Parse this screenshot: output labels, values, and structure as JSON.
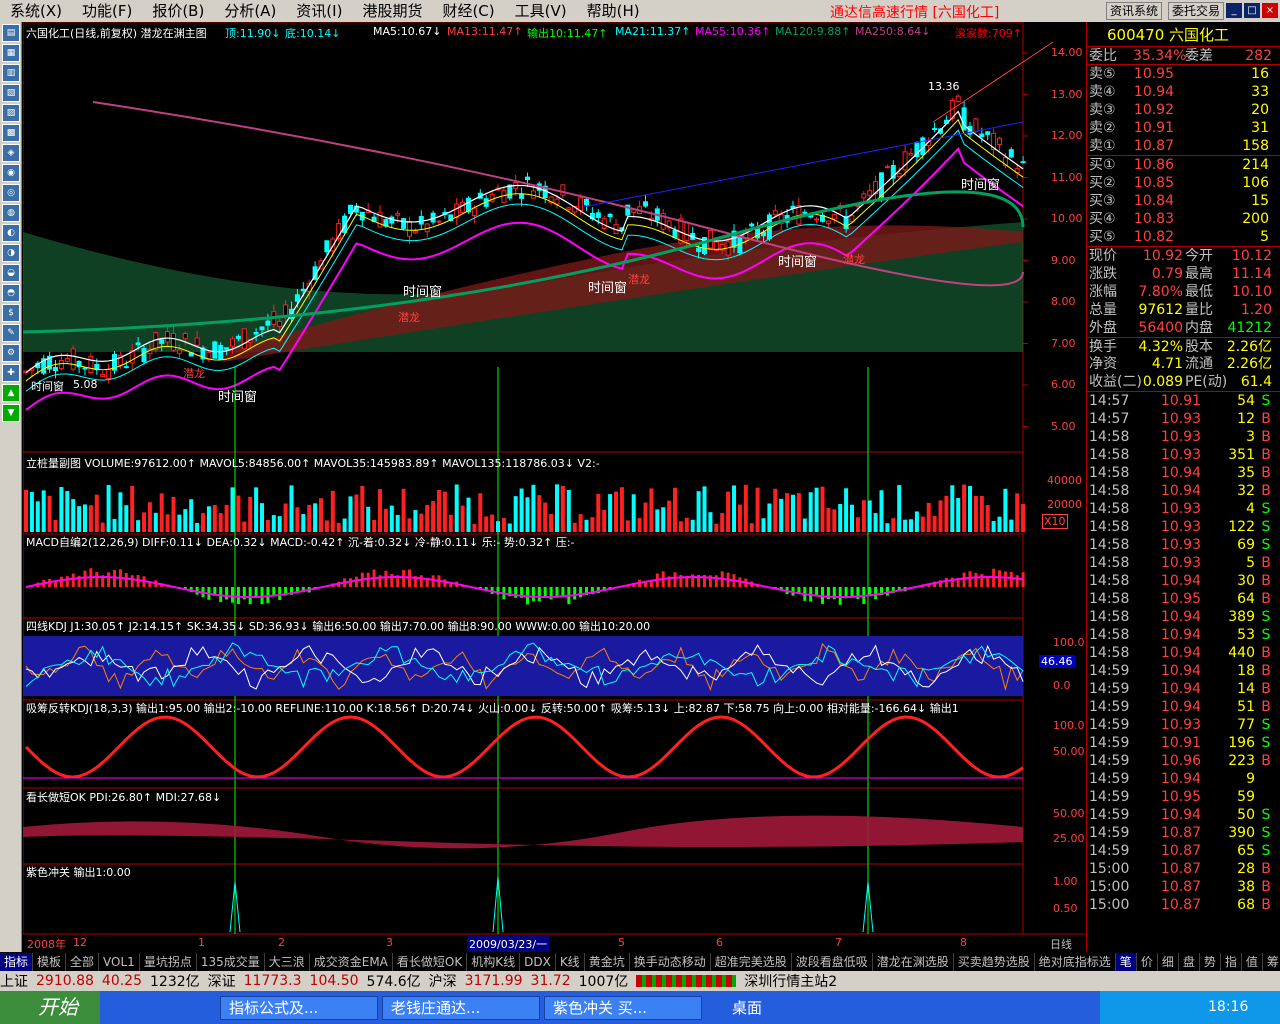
{
  "menu": {
    "items": [
      "系统(X)",
      "功能(F)",
      "报价(B)",
      "分析(A)",
      "资讯(I)",
      "港股期货",
      "财经(C)",
      "工具(V)",
      "帮助(H)"
    ],
    "title": "通达信高速行情 [六国化工]",
    "btn_info": "资讯系统",
    "btn_trade": "委托交易"
  },
  "main_chart": {
    "header": [
      "六国化工(日线,前复权) 潜龙在渊主图",
      "顶:11.90↓",
      "底:10.14↓",
      "MA5:10.67↓",
      "MA13:11.47↑",
      "输出10:11.47↑",
      "MA21:11.37↑",
      "MA55:10.36↑",
      "MA120:9.88↑",
      "MA250:8.64↓",
      "滚家数:709↑"
    ],
    "price_ticks": [
      "14.00",
      "13.00",
      "12.00",
      "11.00",
      "10.00",
      "9.00",
      "8.00",
      "7.00",
      "6.00",
      "5.00"
    ],
    "annotations": [
      "13.36",
      "时间窗",
      "时间窗",
      "时间窗",
      "时间窗",
      "时间窗",
      "潜龙",
      "潜龙",
      "潜龙",
      "潜龙"
    ],
    "low_label": "5.08"
  },
  "vol_panel": {
    "header": "立桩量副图 VOLUME:97612.00↑ MAVOL5:84856.00↑ MAVOL35:145983.89↑ MAVOL135:118786.03↓ V2:-",
    "ticks": [
      "40000",
      "20000",
      "X10"
    ]
  },
  "macd_panel": {
    "header": "MACD自编2(12,26,9) DIFF:0.11↓ DEA:0.32↓ MACD:-0.42↑ 沉-着:0.32↓ 冷-静:0.11↓ 乐:- 势:0.32↑ 压:-"
  },
  "kdj_panel": {
    "header": "四线KDJ J1:30.05↑ J2:14.15↑ SK:34.35↓ SD:36.93↓ 输出6:50.00 输出7:70.00 输出8:90.00 WWW:0.00 输出10:20.00",
    "ticks": [
      "100.0",
      "46.46",
      "0.0"
    ]
  },
  "xf_panel": {
    "header": "吸筹反转KDJ(18,3,3) 输出1:95.00 输出2:-10.00 REFLINE:110.00 K:18.56↑ D:20.74↓ 火山:0.00↓ 反转:50.00↑ 吸筹:5.13↓ 上:82.87 下:58.75 向上:0.00 相对能量:-166.64↓ 输出1",
    "ticks": [
      "100.0",
      "50.00"
    ]
  },
  "kc_panel": {
    "header": "看长做短OK PDI:26.80↑ MDI:27.68↓",
    "ticks": [
      "50.00",
      "25.00"
    ]
  },
  "purple_panel": {
    "header": "紫色冲关 输出1:0.00",
    "ticks": [
      "1.00",
      "0.50"
    ]
  },
  "xaxis": {
    "labels": [
      "2008年",
      "12",
      "1",
      "2",
      "3",
      "2009/03/23/一",
      "5",
      "6",
      "7",
      "8"
    ],
    "right": "日线"
  },
  "stock": {
    "code": "600470",
    "name": "六国化工",
    "weibi_label": "委比",
    "weibi": "35.34%",
    "weicha_label": "委差",
    "weicha": "282",
    "asks": [
      {
        "label": "卖⑤",
        "price": "10.95",
        "vol": "16"
      },
      {
        "label": "卖④",
        "price": "10.94",
        "vol": "33"
      },
      {
        "label": "卖③",
        "price": "10.92",
        "vol": "20"
      },
      {
        "label": "卖②",
        "price": "10.91",
        "vol": "31"
      },
      {
        "label": "卖①",
        "price": "10.87",
        "vol": "158"
      }
    ],
    "bids": [
      {
        "label": "买①",
        "price": "10.86",
        "vol": "214"
      },
      {
        "label": "买②",
        "price": "10.85",
        "vol": "106"
      },
      {
        "label": "买③",
        "price": "10.84",
        "vol": "15"
      },
      {
        "label": "买④",
        "price": "10.83",
        "vol": "200"
      },
      {
        "label": "买⑤",
        "price": "10.82",
        "vol": "5"
      }
    ],
    "quote": [
      [
        "现价",
        "10.92",
        "今开",
        "10.12"
      ],
      [
        "涨跌",
        "0.79",
        "最高",
        "11.14"
      ],
      [
        "涨幅",
        "7.80%",
        "最低",
        "10.10"
      ],
      [
        "总量",
        "97612",
        "量比",
        "1.20"
      ],
      [
        "外盘",
        "56400",
        "内盘",
        "41212"
      ],
      [
        "换手",
        "4.32%",
        "股本",
        "2.26亿"
      ],
      [
        "净资",
        "4.71",
        "流通",
        "2.26亿"
      ],
      [
        "收益(二)",
        "0.089",
        "PE(动)",
        "61.4"
      ]
    ],
    "ticks": [
      [
        "14:57",
        "10.91",
        "54",
        "S"
      ],
      [
        "14:57",
        "10.93",
        "12",
        "B"
      ],
      [
        "14:58",
        "10.93",
        "3",
        "B"
      ],
      [
        "14:58",
        "10.93",
        "351",
        "B"
      ],
      [
        "14:58",
        "10.94",
        "35",
        "B"
      ],
      [
        "14:58",
        "10.94",
        "32",
        "B"
      ],
      [
        "14:58",
        "10.93",
        "4",
        "S"
      ],
      [
        "14:58",
        "10.93",
        "122",
        "S"
      ],
      [
        "14:58",
        "10.93",
        "69",
        "S"
      ],
      [
        "14:58",
        "10.93",
        "5",
        "B"
      ],
      [
        "14:58",
        "10.94",
        "30",
        "B"
      ],
      [
        "14:58",
        "10.95",
        "64",
        "B"
      ],
      [
        "14:58",
        "10.94",
        "389",
        "S"
      ],
      [
        "14:58",
        "10.94",
        "53",
        "S"
      ],
      [
        "14:58",
        "10.94",
        "440",
        "B"
      ],
      [
        "14:59",
        "10.94",
        "18",
        "B"
      ],
      [
        "14:59",
        "10.94",
        "14",
        "B"
      ],
      [
        "14:59",
        "10.94",
        "51",
        "B"
      ],
      [
        "14:59",
        "10.93",
        "77",
        "S"
      ],
      [
        "14:59",
        "10.91",
        "196",
        "S"
      ],
      [
        "14:59",
        "10.96",
        "223",
        "B"
      ],
      [
        "14:59",
        "10.94",
        "9",
        ""
      ],
      [
        "14:59",
        "10.95",
        "59",
        ""
      ],
      [
        "14:59",
        "10.94",
        "50",
        "S"
      ],
      [
        "14:59",
        "10.87",
        "390",
        "S"
      ],
      [
        "14:59",
        "10.87",
        "65",
        "S"
      ],
      [
        "15:00",
        "10.87",
        "28",
        "B"
      ],
      [
        "15:00",
        "10.87",
        "38",
        "B"
      ],
      [
        "15:00",
        "10.87",
        "68",
        "B"
      ]
    ]
  },
  "tabs": [
    "指标",
    "模板",
    "全部",
    "VOL1",
    "量坑拐点",
    "135成交量",
    "大三浪",
    "成交资金EMA",
    "看长做短OK",
    "机构K线",
    "DDX",
    "K线",
    "黄金坑",
    "换手动态移动",
    "超准完美选股",
    "波段看盘低吸",
    "潜龙在渊选股",
    "买卖趋势选股",
    "绝对底指标选"
  ],
  "side_tabs": [
    "笔",
    "价",
    "细",
    "盘",
    "势",
    "指",
    "值",
    "筹"
  ],
  "index_bar": {
    "sh_label": "上证",
    "sh": "2910.88",
    "sh_chg": "40.25",
    "sh_amt": "1232亿",
    "sz_label": "深证",
    "sz": "11773.3",
    "sz_chg": "104.50",
    "sz_amt": "574.6亿",
    "hs_label": "沪深",
    "hs": "3171.99",
    "hs_chg": "31.72",
    "hs_amt": "1007亿",
    "server": "深圳行情主站2"
  },
  "taskbar": {
    "start": "开始",
    "tasks": [
      "指标公式及...",
      "老钱庄通达...",
      "紫色冲关 买..."
    ],
    "desktop": "桌面",
    "clock": "18:16"
  },
  "colors": {
    "red": "#ff0000",
    "green": "#00ff00",
    "yellow": "#ffff00",
    "cyan": "#00ffff",
    "magenta": "#ff00ff"
  }
}
